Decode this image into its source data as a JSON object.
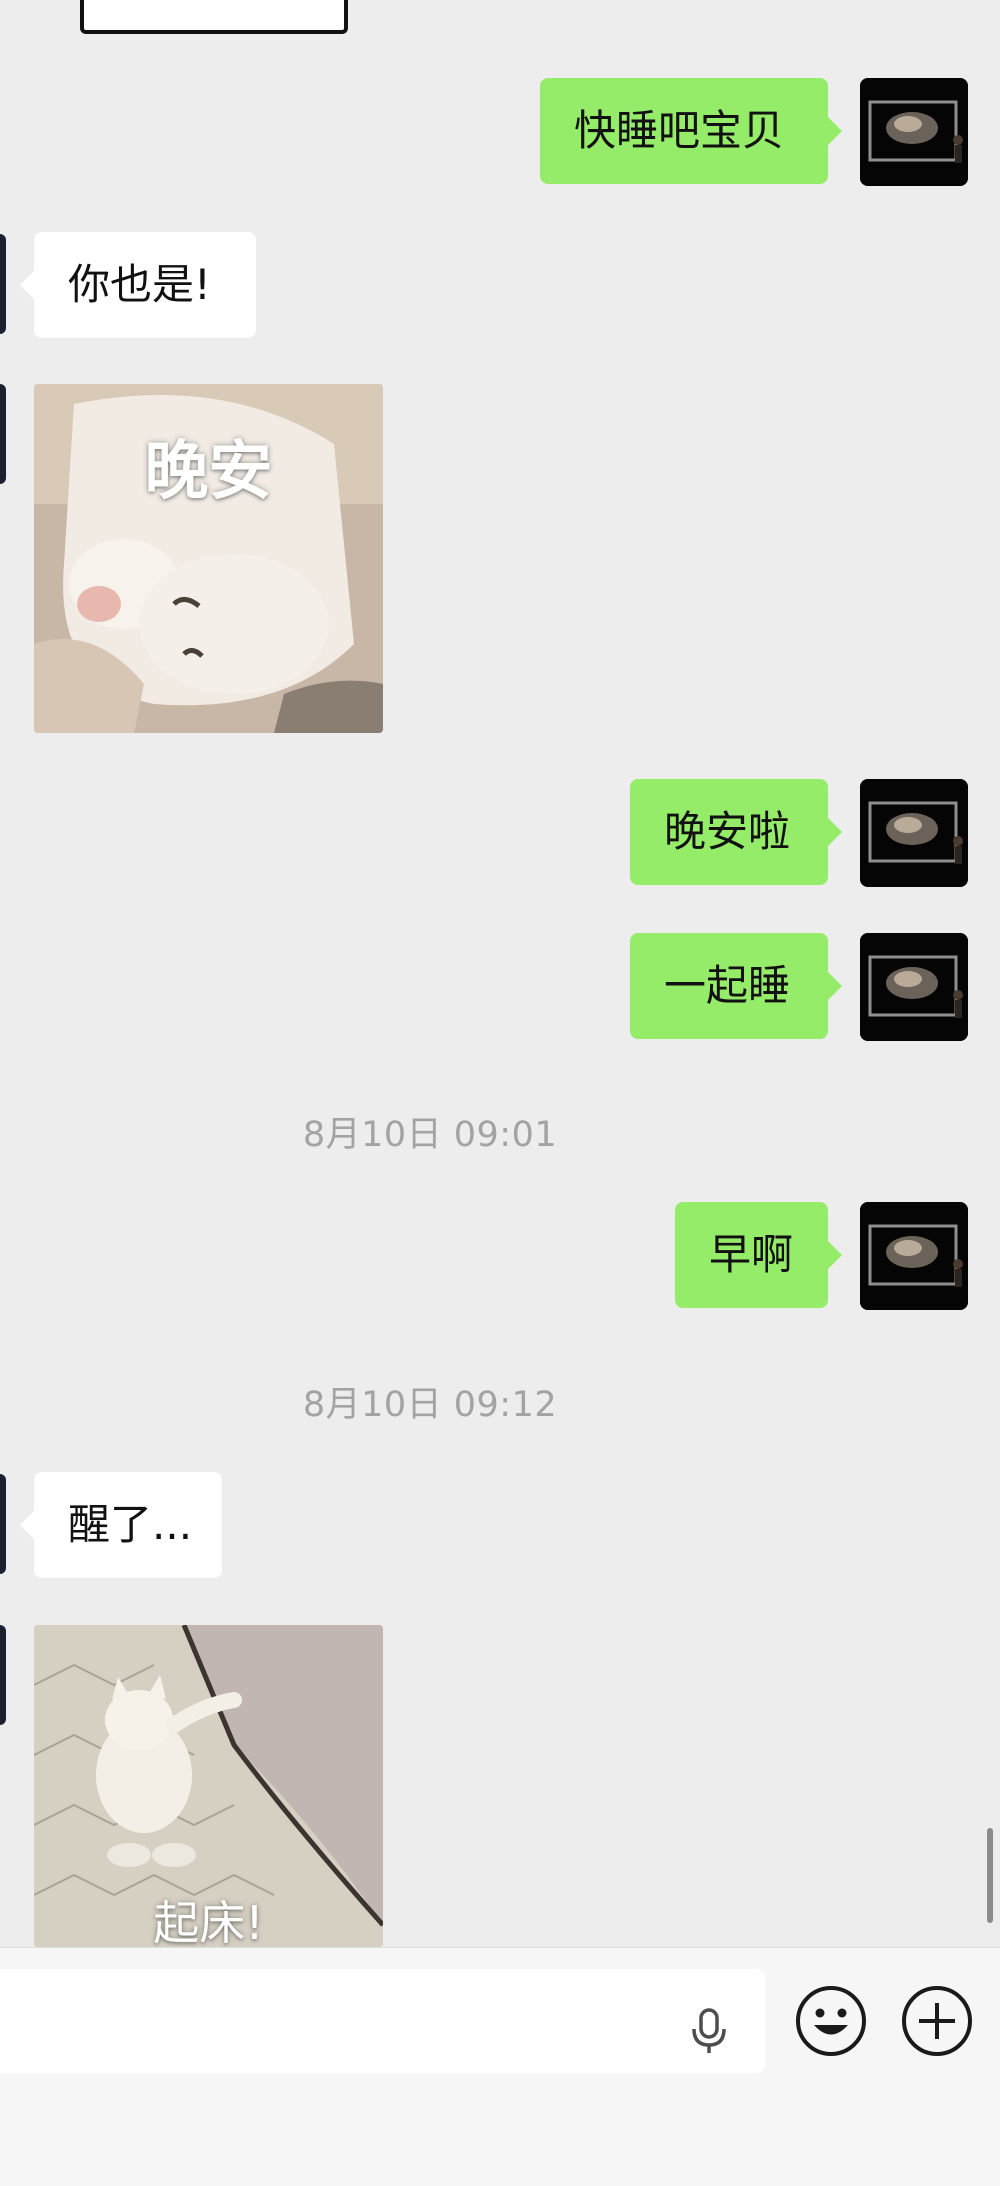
{
  "messages": {
    "m1": "快睡吧宝贝",
    "m2": "你也是!",
    "m3": "晚安啦",
    "m4": "一起睡",
    "m5": "早啊",
    "m6": "醒了..."
  },
  "timestamps": {
    "t1": "8月10日 09:01",
    "t2": "8月10日 09:12"
  },
  "stickers": {
    "s1_caption": "晚安",
    "s2_caption": "起床!"
  },
  "icons": {
    "mic": "microphone-icon",
    "emoji": "smiley-icon",
    "plus": "plus-icon"
  },
  "colors": {
    "sent_bubble": "#95ec69",
    "received_bubble": "#ffffff",
    "background": "#ededed",
    "timestamp_text": "#a3a3a3"
  }
}
